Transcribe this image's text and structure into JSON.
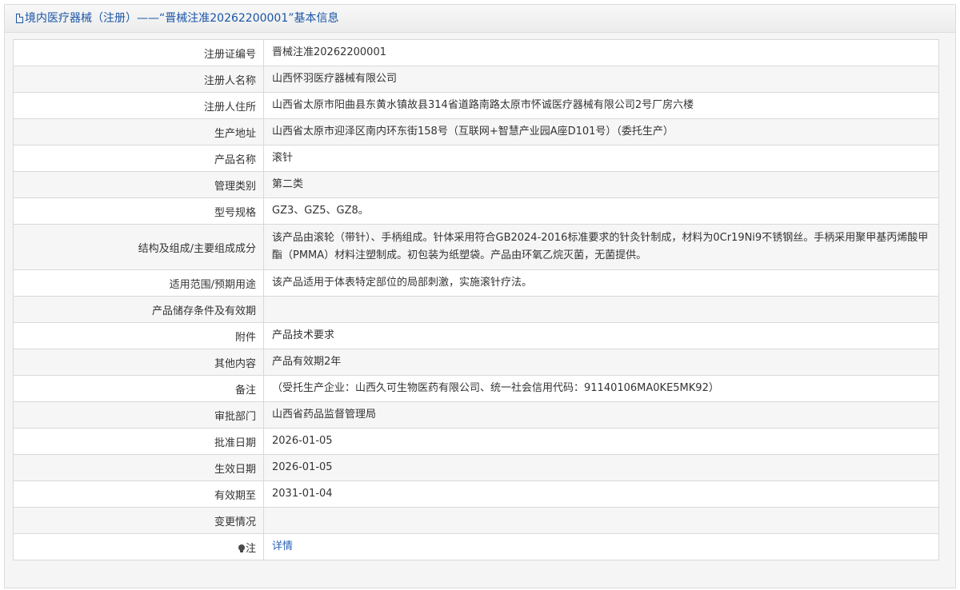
{
  "header": {
    "title": "境内医疗器械（注册）——“晋械注准20262200001”基本信息",
    "icon": "document-icon"
  },
  "rows": [
    {
      "label": "注册证编号",
      "value": "晋械注准20262200001"
    },
    {
      "label": "注册人名称",
      "value": "山西怀羽医疗器械有限公司"
    },
    {
      "label": "注册人住所",
      "value": "山西省太原市阳曲县东黄水镇故县314省道路南路太原市怀诚医疗器械有限公司2号厂房六楼"
    },
    {
      "label": "生产地址",
      "value": "山西省太原市迎泽区南内环东街158号（互联网+智慧产业园A座D101号）（委托生产）"
    },
    {
      "label": "产品名称",
      "value": "滚针"
    },
    {
      "label": "管理类别",
      "value": "第二类"
    },
    {
      "label": "型号规格",
      "value": "GZ3、GZ5、GZ8。"
    },
    {
      "label": "结构及组成/主要组成成分",
      "value": "该产品由滚轮（带针）、手柄组成。针体采用符合GB2024-2016标准要求的针灸针制成，材料为0Cr19Ni9不锈钢丝。手柄采用聚甲基丙烯酸甲酯（PMMA）材料注塑制成。初包装为纸塑袋。产品由环氧乙烷灭菌，无菌提供。"
    },
    {
      "label": "适用范围/预期用途",
      "value": "该产品适用于体表特定部位的局部刺激，实施滚针疗法。"
    },
    {
      "label": "产品储存条件及有效期",
      "value": ""
    },
    {
      "label": "附件",
      "value": "产品技术要求"
    },
    {
      "label": "其他内容",
      "value": "产品有效期2年"
    },
    {
      "label": "备注",
      "value": "（受托生产企业：山西久可生物医药有限公司、统一社会信用代码：91140106MA0KE5MK92）"
    },
    {
      "label": "审批部门",
      "value": "山西省药品监督管理局"
    },
    {
      "label": "批准日期",
      "value": "2026-01-05"
    },
    {
      "label": "生效日期",
      "value": "2026-01-05"
    },
    {
      "label": "有效期至",
      "value": "2031-01-04"
    },
    {
      "label": "变更情况",
      "value": ""
    }
  ],
  "note": {
    "label": "注",
    "link_text": "详情",
    "icon": "lightbulb-icon"
  },
  "colors": {
    "title": "#1a55a6",
    "link": "#2a62b8",
    "border": "#d9d9d9",
    "alt_row": "#f6f6f6"
  }
}
